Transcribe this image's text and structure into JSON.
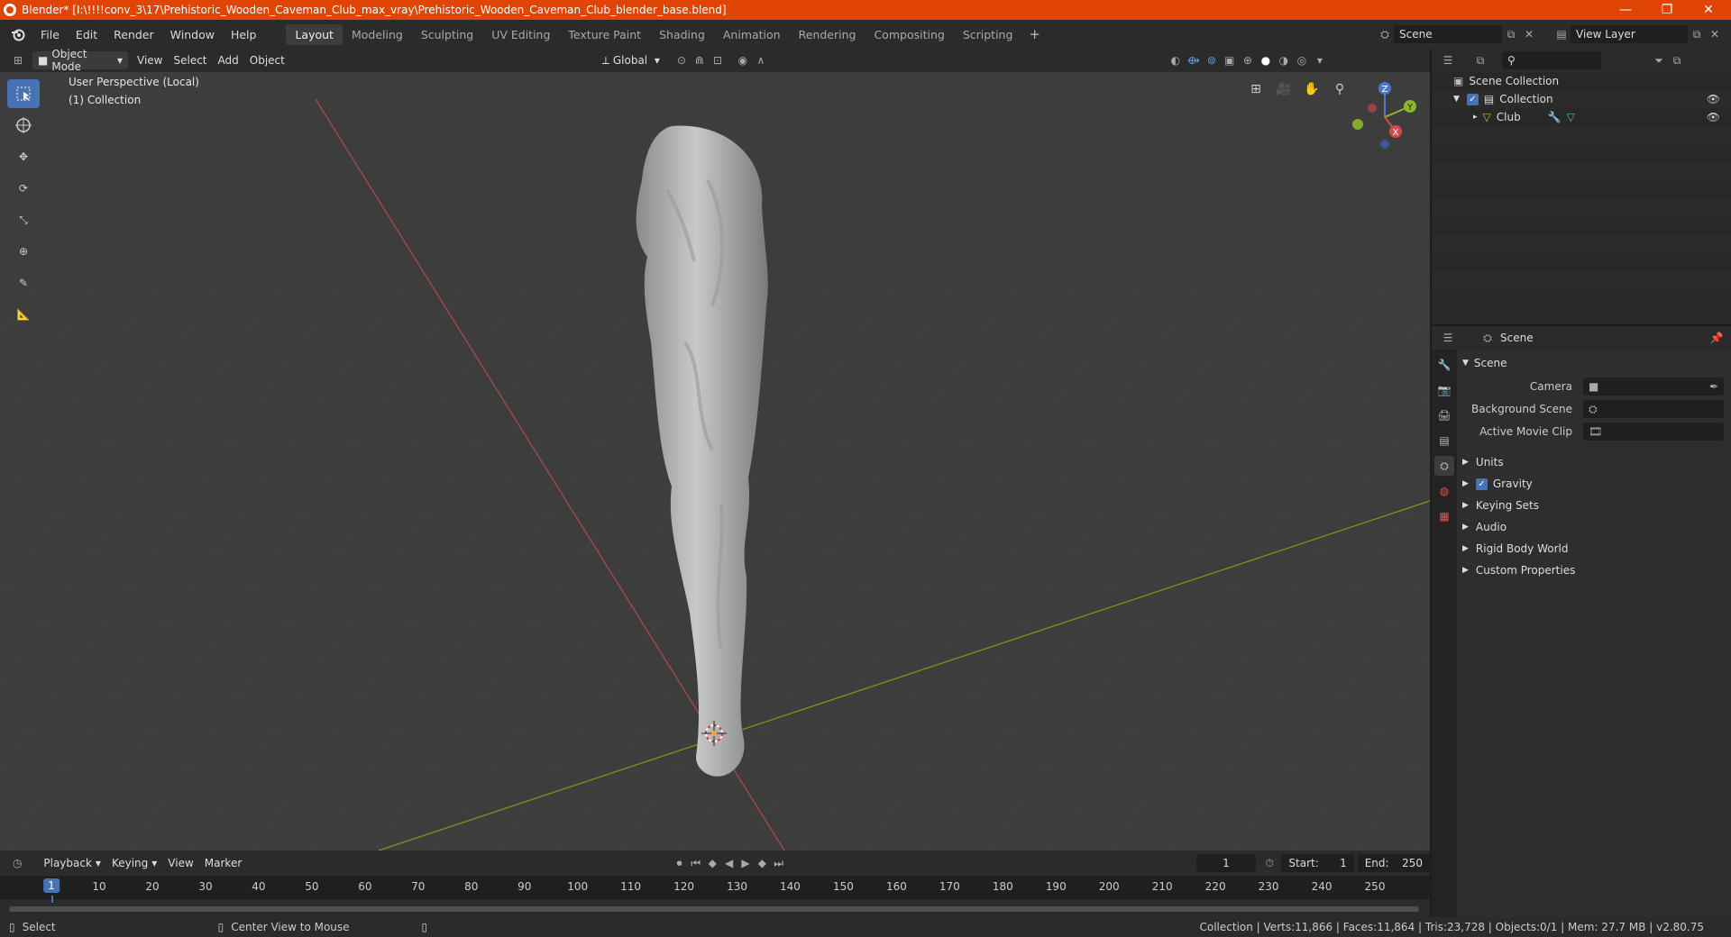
{
  "window": {
    "title": "Blender* [I:\\!!!!conv_3\\17\\Prehistoric_Wooden_Caveman_Club_max_vray\\Prehistoric_Wooden_Caveman_Club_blender_base.blend]",
    "minimize": "—",
    "maximize": "❐",
    "close": "✕"
  },
  "menu": [
    "File",
    "Edit",
    "Render",
    "Window",
    "Help"
  ],
  "workspaces": [
    "Layout",
    "Modeling",
    "Sculpting",
    "UV Editing",
    "Texture Paint",
    "Shading",
    "Animation",
    "Rendering",
    "Compositing",
    "Scripting"
  ],
  "active_workspace": "Layout",
  "scene_name": "Scene",
  "view_layer": "View Layer",
  "viewport_header": {
    "mode": "Object Mode",
    "menus": [
      "View",
      "Select",
      "Add",
      "Object"
    ],
    "orientation": "Global"
  },
  "viewport": {
    "perspective": "User Perspective (Local)",
    "collection": "(1) Collection",
    "gizmo": {
      "z": "Z",
      "y": "Y",
      "x": "X"
    }
  },
  "outliner": {
    "root": "Scene Collection",
    "items": [
      {
        "label": "Collection"
      },
      {
        "label": "Club"
      }
    ]
  },
  "properties": {
    "header": "Scene",
    "section": "Scene",
    "fields": [
      {
        "label": "Camera"
      },
      {
        "label": "Background Scene"
      },
      {
        "label": "Active Movie Clip"
      }
    ],
    "subsections": [
      "Units",
      "Gravity",
      "Keying Sets",
      "Audio",
      "Rigid Body World",
      "Custom Properties"
    ]
  },
  "timeline": {
    "menus": [
      "Playback",
      "Keying",
      "View",
      "Marker"
    ],
    "current_frame": "1",
    "start_label": "Start:",
    "start": "1",
    "end_label": "End:",
    "end": "250",
    "ticks": [
      "1",
      "10",
      "20",
      "30",
      "40",
      "50",
      "60",
      "70",
      "80",
      "90",
      "100",
      "110",
      "120",
      "130",
      "140",
      "150",
      "160",
      "170",
      "180",
      "190",
      "200",
      "210",
      "220",
      "230",
      "240",
      "250"
    ]
  },
  "status": {
    "left": "Select",
    "middle": "Center View to Mouse",
    "right": "Collection | Verts:11,866 | Faces:11,864 | Tris:23,728 | Objects:0/1 | Mem: 27.7 MB | v2.80.75"
  },
  "colors": {
    "accent": "#4772b3",
    "titlebar": "#e04505",
    "x_axis": "#b24a4a",
    "y_axis": "#7a9a22"
  }
}
